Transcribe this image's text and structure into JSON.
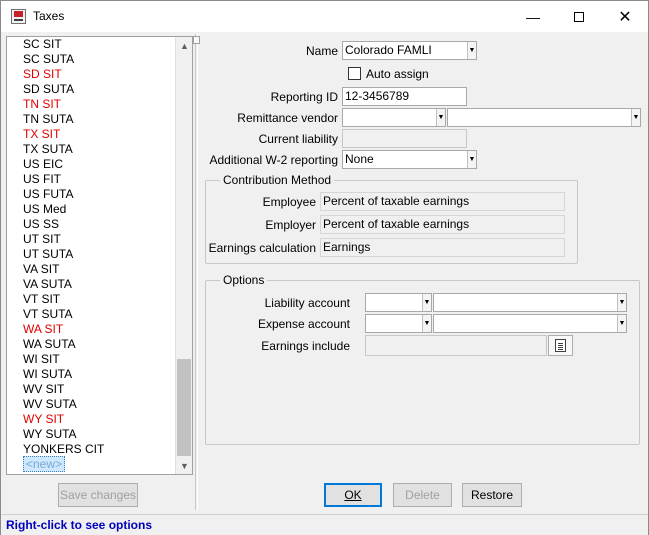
{
  "window": {
    "title": "Taxes"
  },
  "tax_list": {
    "items": [
      {
        "label": "SC SIT",
        "red": false
      },
      {
        "label": "SC SUTA",
        "red": false
      },
      {
        "label": "SD SIT",
        "red": true
      },
      {
        "label": "SD SUTA",
        "red": false
      },
      {
        "label": "TN SIT",
        "red": true
      },
      {
        "label": "TN SUTA",
        "red": false
      },
      {
        "label": "TX SIT",
        "red": true
      },
      {
        "label": "TX SUTA",
        "red": false
      },
      {
        "label": "US EIC",
        "red": false
      },
      {
        "label": "US FIT",
        "red": false
      },
      {
        "label": "US FUTA",
        "red": false
      },
      {
        "label": "US Med",
        "red": false
      },
      {
        "label": "US SS",
        "red": false
      },
      {
        "label": "UT SIT",
        "red": false
      },
      {
        "label": "UT SUTA",
        "red": false
      },
      {
        "label": "VA SIT",
        "red": false
      },
      {
        "label": "VA SUTA",
        "red": false
      },
      {
        "label": "VT SIT",
        "red": false
      },
      {
        "label": "VT SUTA",
        "red": false
      },
      {
        "label": "WA SIT",
        "red": true
      },
      {
        "label": "WA SUTA",
        "red": false
      },
      {
        "label": "WI SIT",
        "red": false
      },
      {
        "label": "WI SUTA",
        "red": false
      },
      {
        "label": "WV SIT",
        "red": false
      },
      {
        "label": "WV SUTA",
        "red": false
      },
      {
        "label": "WY SIT",
        "red": true
      },
      {
        "label": "WY SUTA",
        "red": false
      },
      {
        "label": "YONKERS CIT",
        "red": false
      },
      {
        "label": "<new>",
        "red": false,
        "selected": true
      }
    ],
    "save_label": "Save changes"
  },
  "form": {
    "name_label": "Name",
    "name_value": "Colorado FAMLI",
    "auto_assign_label": "Auto assign",
    "auto_assign_checked": false,
    "reporting_id_label": "Reporting ID",
    "reporting_id_value": "12-3456789",
    "remittance_vendor_label": "Remittance vendor",
    "remittance_vendor_value": "",
    "remittance_vendor_name": "",
    "current_liability_label": "Current liability",
    "current_liability_value": "",
    "w2_label": "Additional W-2 reporting",
    "w2_value": "None"
  },
  "contribution": {
    "title": "Contribution Method",
    "employee_label": "Employee",
    "employee_value": "Percent of taxable earnings",
    "employer_label": "Employer",
    "employer_value": "Percent of taxable earnings",
    "earnings_calc_label": "Earnings calculation",
    "earnings_calc_value": "Earnings"
  },
  "options": {
    "title": "Options",
    "liability_label": "Liability account",
    "liability_value": "",
    "liability_name": "",
    "expense_label": "Expense account",
    "expense_value": "",
    "expense_name": "",
    "earnings_include_label": "Earnings include",
    "earnings_include_value": ""
  },
  "actions": {
    "ok_label": "OK",
    "delete_label": "Delete",
    "restore_label": "Restore"
  },
  "status": {
    "text": "Right-click to see options"
  },
  "colors": {
    "accent": "#0078d7",
    "status_text": "#0000c0",
    "unconfigured": "#e00000"
  }
}
